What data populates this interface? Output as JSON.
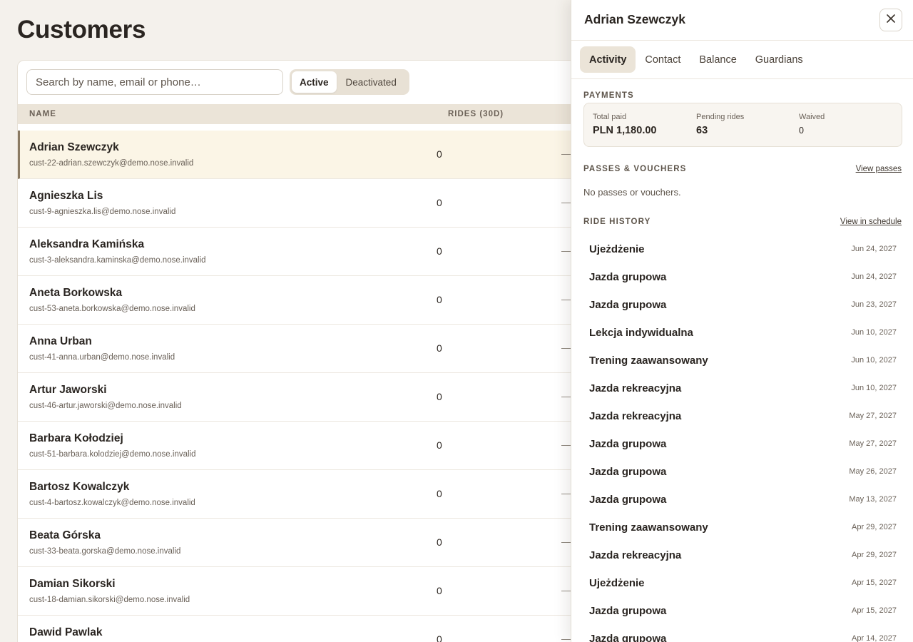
{
  "page": {
    "title": "Customers"
  },
  "search": {
    "placeholder": "Search by name, email or phone…"
  },
  "filter": {
    "options": [
      "Active",
      "Deactivated"
    ],
    "selected": "Active"
  },
  "table": {
    "columns": {
      "name": "NAME",
      "rides": "RIDES (30D)"
    },
    "rows": [
      {
        "name": "Adrian Szewczyk",
        "email": "cust-22-adrian.szewczyk@demo.nose.invalid",
        "rides": "0",
        "extra": "—",
        "selected": true
      },
      {
        "name": "Agnieszka Lis",
        "email": "cust-9-agnieszka.lis@demo.nose.invalid",
        "rides": "0",
        "extra": "—"
      },
      {
        "name": "Aleksandra Kamińska",
        "email": "cust-3-aleksandra.kaminska@demo.nose.invalid",
        "rides": "0",
        "extra": "—"
      },
      {
        "name": "Aneta Borkowska",
        "email": "cust-53-aneta.borkowska@demo.nose.invalid",
        "rides": "0",
        "extra": "—"
      },
      {
        "name": "Anna Urban",
        "email": "cust-41-anna.urban@demo.nose.invalid",
        "rides": "0",
        "extra": "—"
      },
      {
        "name": "Artur Jaworski",
        "email": "cust-46-artur.jaworski@demo.nose.invalid",
        "rides": "0",
        "extra": "—"
      },
      {
        "name": "Barbara Kołodziej",
        "email": "cust-51-barbara.kolodziej@demo.nose.invalid",
        "rides": "0",
        "extra": "—"
      },
      {
        "name": "Bartosz Kowalczyk",
        "email": "cust-4-bartosz.kowalczyk@demo.nose.invalid",
        "rides": "0",
        "extra": "—"
      },
      {
        "name": "Beata Górska",
        "email": "cust-33-beata.gorska@demo.nose.invalid",
        "rides": "0",
        "extra": "—"
      },
      {
        "name": "Damian Sikorski",
        "email": "cust-18-damian.sikorski@demo.nose.invalid",
        "rides": "0",
        "extra": "—"
      },
      {
        "name": "Dawid Pawlak",
        "email": "",
        "rides": "0",
        "extra": "—"
      }
    ]
  },
  "panel": {
    "title": "Adrian Szewczyk",
    "tabs": [
      "Activity",
      "Contact",
      "Balance",
      "Guardians"
    ],
    "active_tab": "Activity",
    "payments": {
      "label": "PAYMENTS",
      "total_paid_label": "Total paid",
      "total_paid": "PLN 1,180.00",
      "pending_label": "Pending rides",
      "pending": "63",
      "waived_label": "Waived",
      "waived": "0"
    },
    "passes": {
      "label": "PASSES & VOUCHERS",
      "link": "View passes",
      "empty": "No passes or vouchers."
    },
    "history": {
      "label": "RIDE HISTORY",
      "link": "View in schedule",
      "items": [
        {
          "title": "Ujeżdżenie",
          "date": "Jun 24, 2027"
        },
        {
          "title": "Jazda grupowa",
          "date": "Jun 24, 2027"
        },
        {
          "title": "Jazda grupowa",
          "date": "Jun 23, 2027"
        },
        {
          "title": "Lekcja indywidualna",
          "date": "Jun 10, 2027"
        },
        {
          "title": "Trening zaawansowany",
          "date": "Jun 10, 2027"
        },
        {
          "title": "Jazda rekreacyjna",
          "date": "Jun 10, 2027"
        },
        {
          "title": "Jazda rekreacyjna",
          "date": "May 27, 2027"
        },
        {
          "title": "Jazda grupowa",
          "date": "May 27, 2027"
        },
        {
          "title": "Jazda grupowa",
          "date": "May 26, 2027"
        },
        {
          "title": "Jazda grupowa",
          "date": "May 13, 2027"
        },
        {
          "title": "Trening zaawansowany",
          "date": "Apr 29, 2027"
        },
        {
          "title": "Jazda rekreacyjna",
          "date": "Apr 29, 2027"
        },
        {
          "title": "Ujeżdżenie",
          "date": "Apr 15, 2027"
        },
        {
          "title": "Jazda grupowa",
          "date": "Apr 15, 2027"
        },
        {
          "title": "Jazda grupowa",
          "date": "Apr 14, 2027"
        }
      ]
    }
  }
}
